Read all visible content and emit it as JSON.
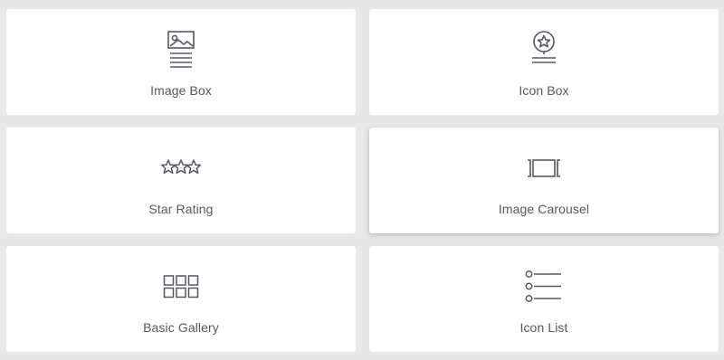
{
  "widgets": [
    {
      "label": "Image Box",
      "icon": "image-box-icon"
    },
    {
      "label": "Icon Box",
      "icon": "icon-box-icon"
    },
    {
      "label": "Star Rating",
      "icon": "star-rating-icon"
    },
    {
      "label": "Image Carousel",
      "icon": "image-carousel-icon"
    },
    {
      "label": "Basic Gallery",
      "icon": "basic-gallery-icon"
    },
    {
      "label": "Icon List",
      "icon": "icon-list-icon"
    }
  ],
  "colors": {
    "background": "#e6e8ea",
    "card": "#ffffff",
    "icon_stroke": "#545961",
    "label_text": "#545961"
  }
}
